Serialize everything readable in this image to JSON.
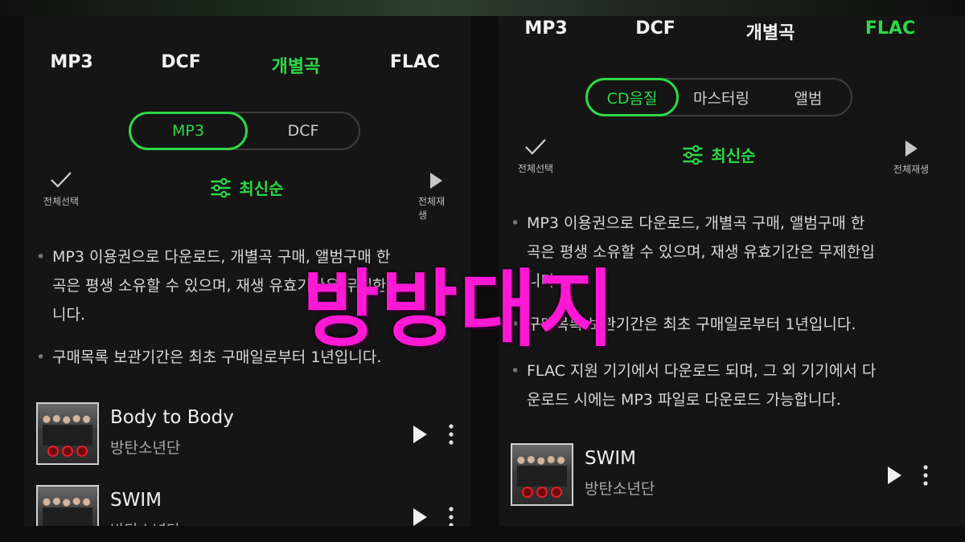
{
  "left": {
    "tabs": [
      {
        "label": "MP3",
        "active": false
      },
      {
        "label": "DCF",
        "active": false
      },
      {
        "label": "개별곡",
        "active": true
      },
      {
        "label": "FLAC",
        "active": false
      }
    ],
    "segment": [
      {
        "label": "MP3",
        "active": true
      },
      {
        "label": "DCF",
        "active": false
      }
    ],
    "select_all_label": "전체선택",
    "sort_label": "최신순",
    "play_all_label": "전체재생",
    "notices": [
      "MP3 이용권으로 다운로드, 개별곡 구매, 앨범구매 한 곡은 평생 소유할 수 있으며, 재생 유효기간은 무제한입니다.",
      "구매목록 보관기간은 최초 구매일로부터 1년입니다."
    ],
    "notice_lines": [
      [
        "MP3 이용권으로 다운로드, 개별곡 구매, 앨범구매 한",
        "곡은 평생 소유할 수 있으며, 재생 유효기간은 무제한입",
        "니다."
      ],
      [
        "구매목록 보관기간은 최초 구매일로부터 1년입니다."
      ]
    ],
    "tracks": [
      {
        "title": "Body to Body",
        "artist": "방탄소년단"
      },
      {
        "title": "SWIM",
        "artist": "방탄소년단"
      }
    ]
  },
  "right": {
    "tabs": [
      {
        "label": "MP3",
        "active": false
      },
      {
        "label": "DCF",
        "active": false
      },
      {
        "label": "개별곡",
        "active": false
      },
      {
        "label": "FLAC",
        "active": true
      }
    ],
    "segment": [
      {
        "label": "CD음질",
        "active": true
      },
      {
        "label": "마스터링",
        "active": false
      },
      {
        "label": "앨범",
        "active": false
      }
    ],
    "select_all_label": "전체선택",
    "sort_label": "최신순",
    "play_all_label": "전체재생",
    "notice_lines": [
      [
        "MP3 이용권으로 다운로드, 개별곡 구매, 앨범구매 한",
        "곡은 평생 소유할 수 있으며, 재생 유효기간은 무제한입",
        "니다."
      ],
      [
        "구매목록 보관기간은 최초 구매일로부터 1년입니다."
      ],
      [
        "FLAC 지원 기기에서 다운로드 되며, 그 외 기기에서 다",
        "운로드 시에는 MP3 파일로 다운로드 가능합니다."
      ]
    ],
    "tracks": [
      {
        "title": "SWIM",
        "artist": "방탄소년단"
      }
    ]
  },
  "watermark": "방방대지",
  "colors": {
    "accent": "#2ed848",
    "watermark": "#ff19d5",
    "background": "#151515"
  },
  "icons": {
    "select_all": "check-icon",
    "sort": "sliders-icon",
    "play_all": "play-icon",
    "track_play": "play-icon",
    "track_more": "more-vertical-icon"
  }
}
